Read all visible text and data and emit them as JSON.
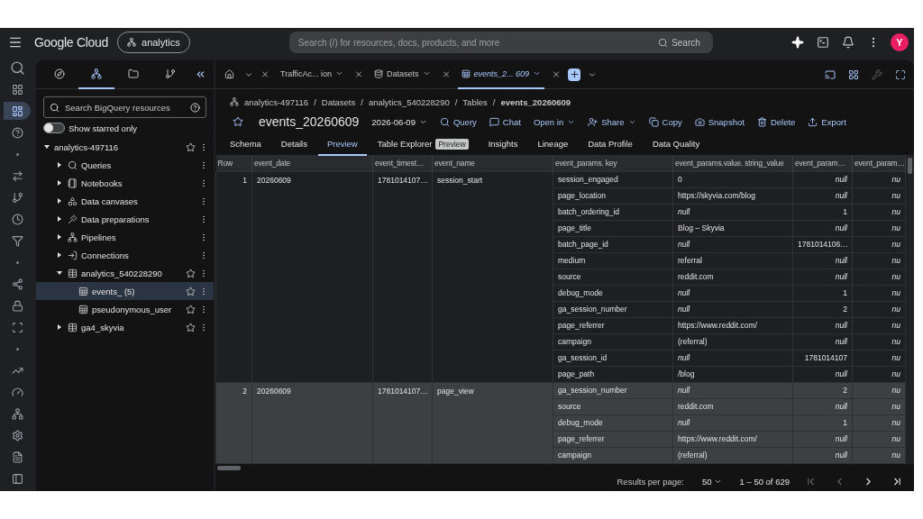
{
  "topbar": {
    "brand": "Google Cloud",
    "project": "analytics",
    "search": {
      "placeholder": "Search (/) for resources, docs, products, and more"
    },
    "search_button": "Search",
    "avatar": "Y"
  },
  "rail": [
    {
      "selected": false
    },
    {
      "selected": false
    },
    {
      "selected": true
    },
    {
      "selected": false
    },
    {
      "selected": false
    },
    {
      "selected": false
    },
    {
      "selected": false
    },
    {
      "selected": false
    },
    {
      "selected": false
    },
    {
      "selected": false
    },
    {
      "selected": false
    },
    {
      "selected": false
    },
    {
      "selected": false
    },
    {
      "selected": false
    },
    {
      "selected": false
    },
    {
      "selected": false
    },
    {
      "selected": false
    },
    {
      "selected": false
    },
    {
      "selected": false
    },
    {
      "selected": false
    }
  ],
  "explorer": {
    "tabs": [
      {
        "selected": false
      },
      {
        "selected": true
      },
      {
        "selected": false
      },
      {
        "selected": false
      }
    ],
    "search": {
      "placeholder": "Search BigQuery resources"
    },
    "toggle": {
      "label": "Show starred only",
      "on": false
    },
    "tree": [
      {
        "kind": "project",
        "label": "analytics-497116",
        "expanded": true,
        "selected": false,
        "children": [
          {
            "kind": "queries",
            "label": "Queries",
            "expanded": false,
            "selected": false
          },
          {
            "kind": "notebooks",
            "label": "Notebooks",
            "expanded": false,
            "selected": false
          },
          {
            "kind": "canvases",
            "label": "Data canvases",
            "expanded": false,
            "selected": false
          },
          {
            "kind": "preparations",
            "label": "Data preparations",
            "expanded": false,
            "selected": false
          },
          {
            "kind": "pipelines",
            "label": "Pipelines",
            "expanded": false,
            "selected": false
          },
          {
            "kind": "connections",
            "label": "Connections",
            "expanded": false,
            "selected": false
          },
          {
            "kind": "dataset",
            "label": "analytics_540228290",
            "expanded": true,
            "selected": false,
            "children": [
              {
                "kind": "table",
                "label": "events_ (5)",
                "selected": true
              },
              {
                "kind": "table",
                "label": "pseudonymous_user",
                "selected": false
              }
            ]
          },
          {
            "kind": "dataset",
            "label": "ga4_skyvia",
            "expanded": false,
            "selected": false
          }
        ]
      }
    ]
  },
  "editor_tabs": [
    {
      "label": "TrafficAc... ion",
      "kind": "query",
      "selected": false
    },
    {
      "label": "Datasets",
      "kind": "datasets",
      "selected": false
    },
    {
      "label": "events_2... 609",
      "kind": "table",
      "selected": true
    }
  ],
  "breadcrumb": {
    "separator": "/",
    "items": [
      "analytics-497116",
      "Datasets",
      "analytics_540228290",
      "Tables",
      "events_20260609"
    ]
  },
  "title": "events_20260609",
  "date": "2026-06-09",
  "actions": [
    {
      "kind": "query",
      "label": "Query"
    },
    {
      "kind": "chat",
      "label": "Chat"
    },
    {
      "kind": "open",
      "label": "Open in"
    },
    {
      "kind": "share",
      "label": "Share"
    },
    {
      "kind": "copy",
      "label": "Copy"
    },
    {
      "kind": "snapshot",
      "label": "Snapshot"
    },
    {
      "kind": "delete",
      "label": "Delete"
    },
    {
      "kind": "export",
      "label": "Export"
    }
  ],
  "subtabs": [
    {
      "label": "Schema",
      "selected": false
    },
    {
      "label": "Details",
      "selected": false
    },
    {
      "label": "Preview",
      "selected": true
    },
    {
      "label": "Table Explorer",
      "badge": "Preview",
      "selected": false
    },
    {
      "label": "Insights",
      "selected": false
    },
    {
      "label": "Lineage",
      "selected": false
    },
    {
      "label": "Data Profile",
      "selected": false
    },
    {
      "label": "Data Quality",
      "selected": false
    }
  ],
  "table": {
    "columns": [
      "Row",
      "event_date",
      "event_timest…",
      "event_name",
      "event_params. key",
      "event_params.value. string_value",
      "event_param…",
      "event_param…"
    ],
    "rows": [
      {
        "row": "1",
        "event_date": "20260609",
        "event_timestamp": "1781014107…",
        "event_name": "session_start",
        "selected": false,
        "params": [
          {
            "key": "session_engaged",
            "string_value": {
              "text": "0",
              "is_null": false
            },
            "column_7": {
              "text": "null",
              "is_null": true
            },
            "column_8": {
              "text": "nu",
              "is_null": true
            }
          },
          {
            "key": "page_location",
            "string_value": {
              "text": "https://skyvia.com/blog",
              "is_null": false
            },
            "column_7": {
              "text": "null",
              "is_null": true
            },
            "column_8": {
              "text": "nu",
              "is_null": true
            }
          },
          {
            "key": "batch_ordering_id",
            "string_value": {
              "text": "null",
              "is_null": true
            },
            "column_7": {
              "text": "1",
              "is_null": false
            },
            "column_8": {
              "text": "nu",
              "is_null": true
            }
          },
          {
            "key": "page_title",
            "string_value": {
              "text": "Blog – Skyvia",
              "is_null": false
            },
            "column_7": {
              "text": "null",
              "is_null": true
            },
            "column_8": {
              "text": "nu",
              "is_null": true
            }
          },
          {
            "key": "batch_page_id",
            "string_value": {
              "text": "null",
              "is_null": true
            },
            "column_7": {
              "text": "1781014106…",
              "is_null": false
            },
            "column_8": {
              "text": "nu",
              "is_null": true
            }
          },
          {
            "key": "medium",
            "string_value": {
              "text": "referral",
              "is_null": false
            },
            "column_7": {
              "text": "null",
              "is_null": true
            },
            "column_8": {
              "text": "nu",
              "is_null": true
            }
          },
          {
            "key": "source",
            "string_value": {
              "text": "reddit.com",
              "is_null": false
            },
            "column_7": {
              "text": "null",
              "is_null": true
            },
            "column_8": {
              "text": "nu",
              "is_null": true
            }
          },
          {
            "key": "debug_mode",
            "string_value": {
              "text": "null",
              "is_null": true
            },
            "column_7": {
              "text": "1",
              "is_null": false
            },
            "column_8": {
              "text": "nu",
              "is_null": true
            }
          },
          {
            "key": "ga_session_number",
            "string_value": {
              "text": "null",
              "is_null": true
            },
            "column_7": {
              "text": "2",
              "is_null": false
            },
            "column_8": {
              "text": "nu",
              "is_null": true
            }
          },
          {
            "key": "page_referrer",
            "string_value": {
              "text": "https://www.reddit.com/",
              "is_null": false
            },
            "column_7": {
              "text": "null",
              "is_null": true
            },
            "column_8": {
              "text": "nu",
              "is_null": true
            }
          },
          {
            "key": "campaign",
            "string_value": {
              "text": "(referral)",
              "is_null": false
            },
            "column_7": {
              "text": "null",
              "is_null": true
            },
            "column_8": {
              "text": "nu",
              "is_null": true
            }
          },
          {
            "key": "ga_session_id",
            "string_value": {
              "text": "null",
              "is_null": true
            },
            "column_7": {
              "text": "1781014107",
              "is_null": false
            },
            "column_8": {
              "text": "nu",
              "is_null": true
            }
          },
          {
            "key": "page_path",
            "string_value": {
              "text": "/blog",
              "is_null": false
            },
            "column_7": {
              "text": "null",
              "is_null": true
            },
            "column_8": {
              "text": "nu",
              "is_null": true
            }
          }
        ]
      },
      {
        "row": "2",
        "event_date": "20260609",
        "event_timestamp": "1781014107…",
        "event_name": "page_view",
        "selected": true,
        "params": [
          {
            "key": "ga_session_number",
            "string_value": {
              "text": "null",
              "is_null": true
            },
            "column_7": {
              "text": "2",
              "is_null": false
            },
            "column_8": {
              "text": "nu",
              "is_null": true
            }
          },
          {
            "key": "source",
            "string_value": {
              "text": "reddit.com",
              "is_null": false
            },
            "column_7": {
              "text": "null",
              "is_null": true
            },
            "column_8": {
              "text": "nu",
              "is_null": true
            }
          },
          {
            "key": "debug_mode",
            "string_value": {
              "text": "null",
              "is_null": true
            },
            "column_7": {
              "text": "1",
              "is_null": false
            },
            "column_8": {
              "text": "nu",
              "is_null": true
            }
          },
          {
            "key": "page_referrer",
            "string_value": {
              "text": "https://www.reddit.com/",
              "is_null": false
            },
            "column_7": {
              "text": "null",
              "is_null": true
            },
            "column_8": {
              "text": "nu",
              "is_null": true
            }
          },
          {
            "key": "campaign",
            "string_value": {
              "text": "(referral)",
              "is_null": false
            },
            "column_7": {
              "text": "null",
              "is_null": true
            },
            "column_8": {
              "text": "nu",
              "is_null": true
            }
          }
        ]
      }
    ]
  },
  "footer": {
    "label": "Results per page:",
    "per_page": "50",
    "range": "1 – 50 of 629"
  }
}
